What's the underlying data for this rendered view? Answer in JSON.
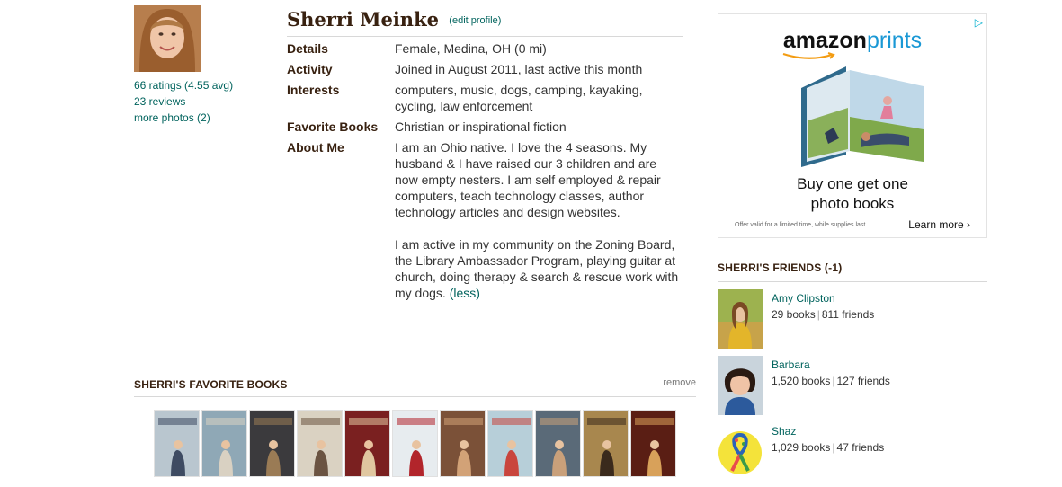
{
  "profile": {
    "name": "Sherri Meinke",
    "edit_label": "(edit profile)",
    "ratings_link": "66 ratings (4.55 avg)",
    "reviews_link": "23 reviews",
    "photos_link": "more photos (2)"
  },
  "details": [
    {
      "label": "Details",
      "value": "Female, Medina, OH (0 mi)"
    },
    {
      "label": "Activity",
      "value": "Joined in August 2011, last active this month"
    },
    {
      "label": "Interests",
      "value": "computers, music, dogs, camping, kayaking, cycling, law enforcement"
    },
    {
      "label": "Favorite Books",
      "value": "Christian or inspirational fiction"
    }
  ],
  "about": {
    "label": "About Me",
    "paragraph1": "I am an Ohio native. I love the 4 seasons. My husband & I have raised our 3 children and are now empty nesters. I am self employed & repair computers, teach technology classes, author technology articles and design websites.",
    "paragraph2": "I am active in my community on the Zoning Board, the Library Ambassador Program, playing guitar at church, doing therapy & search & rescue work with my dogs.",
    "less_label": "(less)"
  },
  "favorite_books": {
    "title": "SHERRI'S FAVORITE BOOKS",
    "remove_label": "remove",
    "covers": [
      {
        "text": "Plain Perfect",
        "bg": "#b9c6cf",
        "accent": "#3e4b62"
      },
      {
        "text": "An Amish Christmas",
        "bg": "#8fa8b6",
        "accent": "#d9d1c2"
      },
      {
        "text": "Secrets of Harmony Grove",
        "bg": "#3b3a3d",
        "accent": "#9a7b55"
      },
      {
        "text": "Christmas Miracle",
        "bg": "#dad2c2",
        "accent": "#6b5442"
      },
      {
        "text": "Journey",
        "bg": "#7a2020",
        "accent": "#e0c7a0"
      },
      {
        "text": "Christmas Kitchen",
        "bg": "#e7ecef",
        "accent": "#b2252b"
      },
      {
        "text": "Hearts",
        "bg": "#7b5138",
        "accent": "#d2a277"
      },
      {
        "text": "A Plain and Fancy Christmas",
        "bg": "#b7cfd9",
        "accent": "#c9453d"
      },
      {
        "text": "Big",
        "bg": "#5a6a78",
        "accent": "#c9a07a"
      },
      {
        "text": "Falling to Pieces",
        "bg": "#a8874e",
        "accent": "#3a2a1c"
      },
      {
        "text": "Wounded Heart",
        "bg": "#5a1e14",
        "accent": "#d8a15a"
      }
    ]
  },
  "ad": {
    "brand_amazon": "amazon",
    "brand_prints": "prints",
    "headline_line1": "Buy one get one",
    "headline_line2": "photo books",
    "fine_print": "Offer valid for a limited time, while supplies last",
    "learn_more": "Learn more ›",
    "choices_icon": "▷"
  },
  "friends": {
    "title": "SHERRI'S FRIENDS (-1)",
    "list": [
      {
        "name": "Amy Clipston",
        "books": "29 books",
        "friends": "811 friends"
      },
      {
        "name": "Barbara",
        "books": "1,520 books",
        "friends": "127 friends"
      },
      {
        "name": "Shaz",
        "books": "1,029 books",
        "friends": "47 friends"
      }
    ]
  },
  "colors": {
    "accent_link": "#00635d",
    "heading_brown": "#382110",
    "amazon_blue": "#1a98d5"
  }
}
